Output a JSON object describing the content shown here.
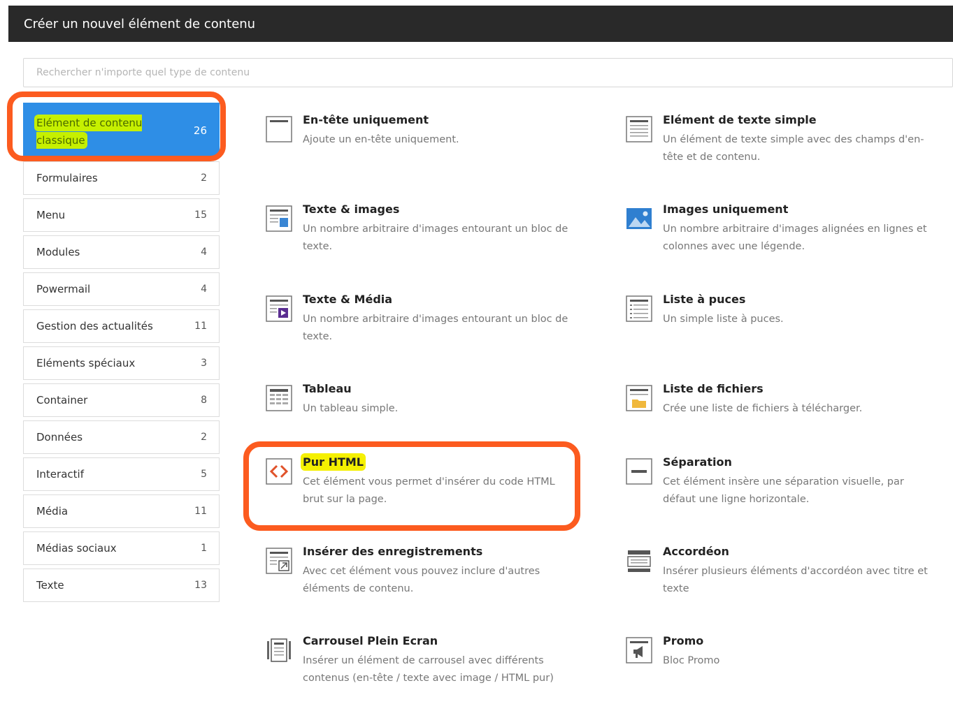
{
  "window": {
    "title": "Créer un nouvel élément de contenu"
  },
  "search": {
    "placeholder": "Rechercher n'importe quel type de contenu"
  },
  "tabs": [
    {
      "label": "Elément de contenu classique",
      "count": "26"
    },
    {
      "label": "Formulaires",
      "count": "2"
    },
    {
      "label": "Menu",
      "count": "15"
    },
    {
      "label": "Modules",
      "count": "4"
    },
    {
      "label": "Powermail",
      "count": "4"
    },
    {
      "label": "Gestion des actualités",
      "count": "11"
    },
    {
      "label": "Eléments spéciaux",
      "count": "3"
    },
    {
      "label": "Container",
      "count": "8"
    },
    {
      "label": "Données",
      "count": "2"
    },
    {
      "label": "Interactif",
      "count": "5"
    },
    {
      "label": "Média",
      "count": "11"
    },
    {
      "label": "Médias sociaux",
      "count": "1"
    },
    {
      "label": "Texte",
      "count": "13"
    }
  ],
  "items": [
    {
      "icon": "header-icon",
      "title": "En-tête uniquement",
      "desc": "Ajoute un en-tête uniquement."
    },
    {
      "icon": "text-icon",
      "title": "Elément de texte simple",
      "desc": "Un élément de texte simple avec des champs d'en-tête et de contenu."
    },
    {
      "icon": "text-image-icon",
      "title": "Texte & images",
      "desc": "Un nombre arbitraire d'images entourant un bloc de texte."
    },
    {
      "icon": "images-icon",
      "title": "Images uniquement",
      "desc": "Un nombre arbitraire d'images alignées en lignes et colonnes avec une légende."
    },
    {
      "icon": "text-media-icon",
      "title": "Texte & Média",
      "desc": "Un nombre arbitraire d'images entourant un bloc de texte."
    },
    {
      "icon": "bullet-list-icon",
      "title": "Liste à puces",
      "desc": "Un simple liste à puces."
    },
    {
      "icon": "table-icon",
      "title": "Tableau",
      "desc": "Un tableau simple."
    },
    {
      "icon": "file-list-icon",
      "title": "Liste de fichiers",
      "desc": "Crée une liste de fichiers à télécharger."
    },
    {
      "icon": "html-icon",
      "title": "Pur HTML",
      "desc": "Cet élément vous permet d'insérer du code HTML brut sur la page."
    },
    {
      "icon": "divider-icon",
      "title": "Séparation",
      "desc": "Cet élément insère une séparation visuelle, par défaut une ligne horizontale."
    },
    {
      "icon": "records-icon",
      "title": "Insérer des enregistrements",
      "desc": "Avec cet élément vous pouvez inclure d'autres éléments de contenu."
    },
    {
      "icon": "accordion-icon",
      "title": "Accordéon",
      "desc": "Insérer plusieurs éléments d'accordéon avec titre et texte"
    },
    {
      "icon": "carousel-icon",
      "title": "Carrousel Plein Ecran",
      "desc": "Insérer un élément de carrousel avec différents contenus (en-tête / texte avec image / HTML pur)"
    },
    {
      "icon": "promo-icon",
      "title": "Promo",
      "desc": "Bloc Promo"
    }
  ],
  "colors": {
    "active_tab": "#2e8ee6",
    "annotation": "#fc5b1f",
    "highlighter": "#f5f000",
    "titlebar": "#292929"
  }
}
